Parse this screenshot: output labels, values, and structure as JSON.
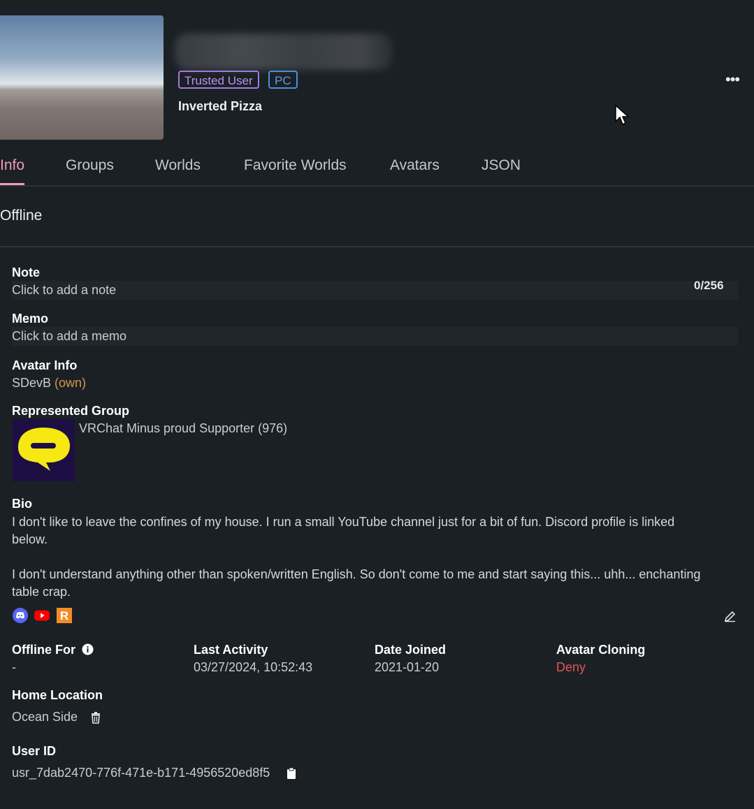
{
  "profile": {
    "badges": {
      "trusted": "Trusted User",
      "platform": "PC"
    },
    "status_description": "Inverted Pizza"
  },
  "tabs": [
    {
      "label": "Info",
      "active": true
    },
    {
      "label": "Groups"
    },
    {
      "label": "Worlds"
    },
    {
      "label": "Favorite Worlds"
    },
    {
      "label": "Avatars"
    },
    {
      "label": "JSON"
    }
  ],
  "status": "Offline",
  "note": {
    "label": "Note",
    "placeholder": "Click to add a note",
    "counter": "0/256"
  },
  "memo": {
    "label": "Memo",
    "placeholder": "Click to add a memo"
  },
  "avatar_info": {
    "label": "Avatar Info",
    "name": "SDevB",
    "tag": "(own)"
  },
  "represented_group": {
    "label": "Represented Group",
    "name": "VRChat Minus proud Supporter",
    "count": "(976)"
  },
  "bio": {
    "label": "Bio",
    "text": "I don't like to leave the confines of my house. I run a small YouTube channel just for a bit of fun. Discord profile is linked below.\n\nI don't understand anything other than spoken/written English. So don't come to me and start saying this... uhh... enchanting table crap."
  },
  "links": [
    "discord-icon",
    "youtube-icon",
    "r-link-icon"
  ],
  "stats": {
    "offline_for": {
      "label": "Offline For",
      "value": "-"
    },
    "last_activity": {
      "label": "Last Activity",
      "value": "03/27/2024, 10:52:43"
    },
    "date_joined": {
      "label": "Date Joined",
      "value": "2021-01-20"
    },
    "avatar_cloning": {
      "label": "Avatar Cloning",
      "value": "Deny"
    }
  },
  "home_location": {
    "label": "Home Location",
    "value": "Ocean Side"
  },
  "user_id": {
    "label": "User ID",
    "value": "usr_7dab2470-776f-471e-b171-4956520ed8f5"
  },
  "colors": {
    "accent": "#f39ab5",
    "trusted": "#a47ae0",
    "pc": "#4a90e2",
    "deny": "#e0555a",
    "own": "#d4964a"
  }
}
